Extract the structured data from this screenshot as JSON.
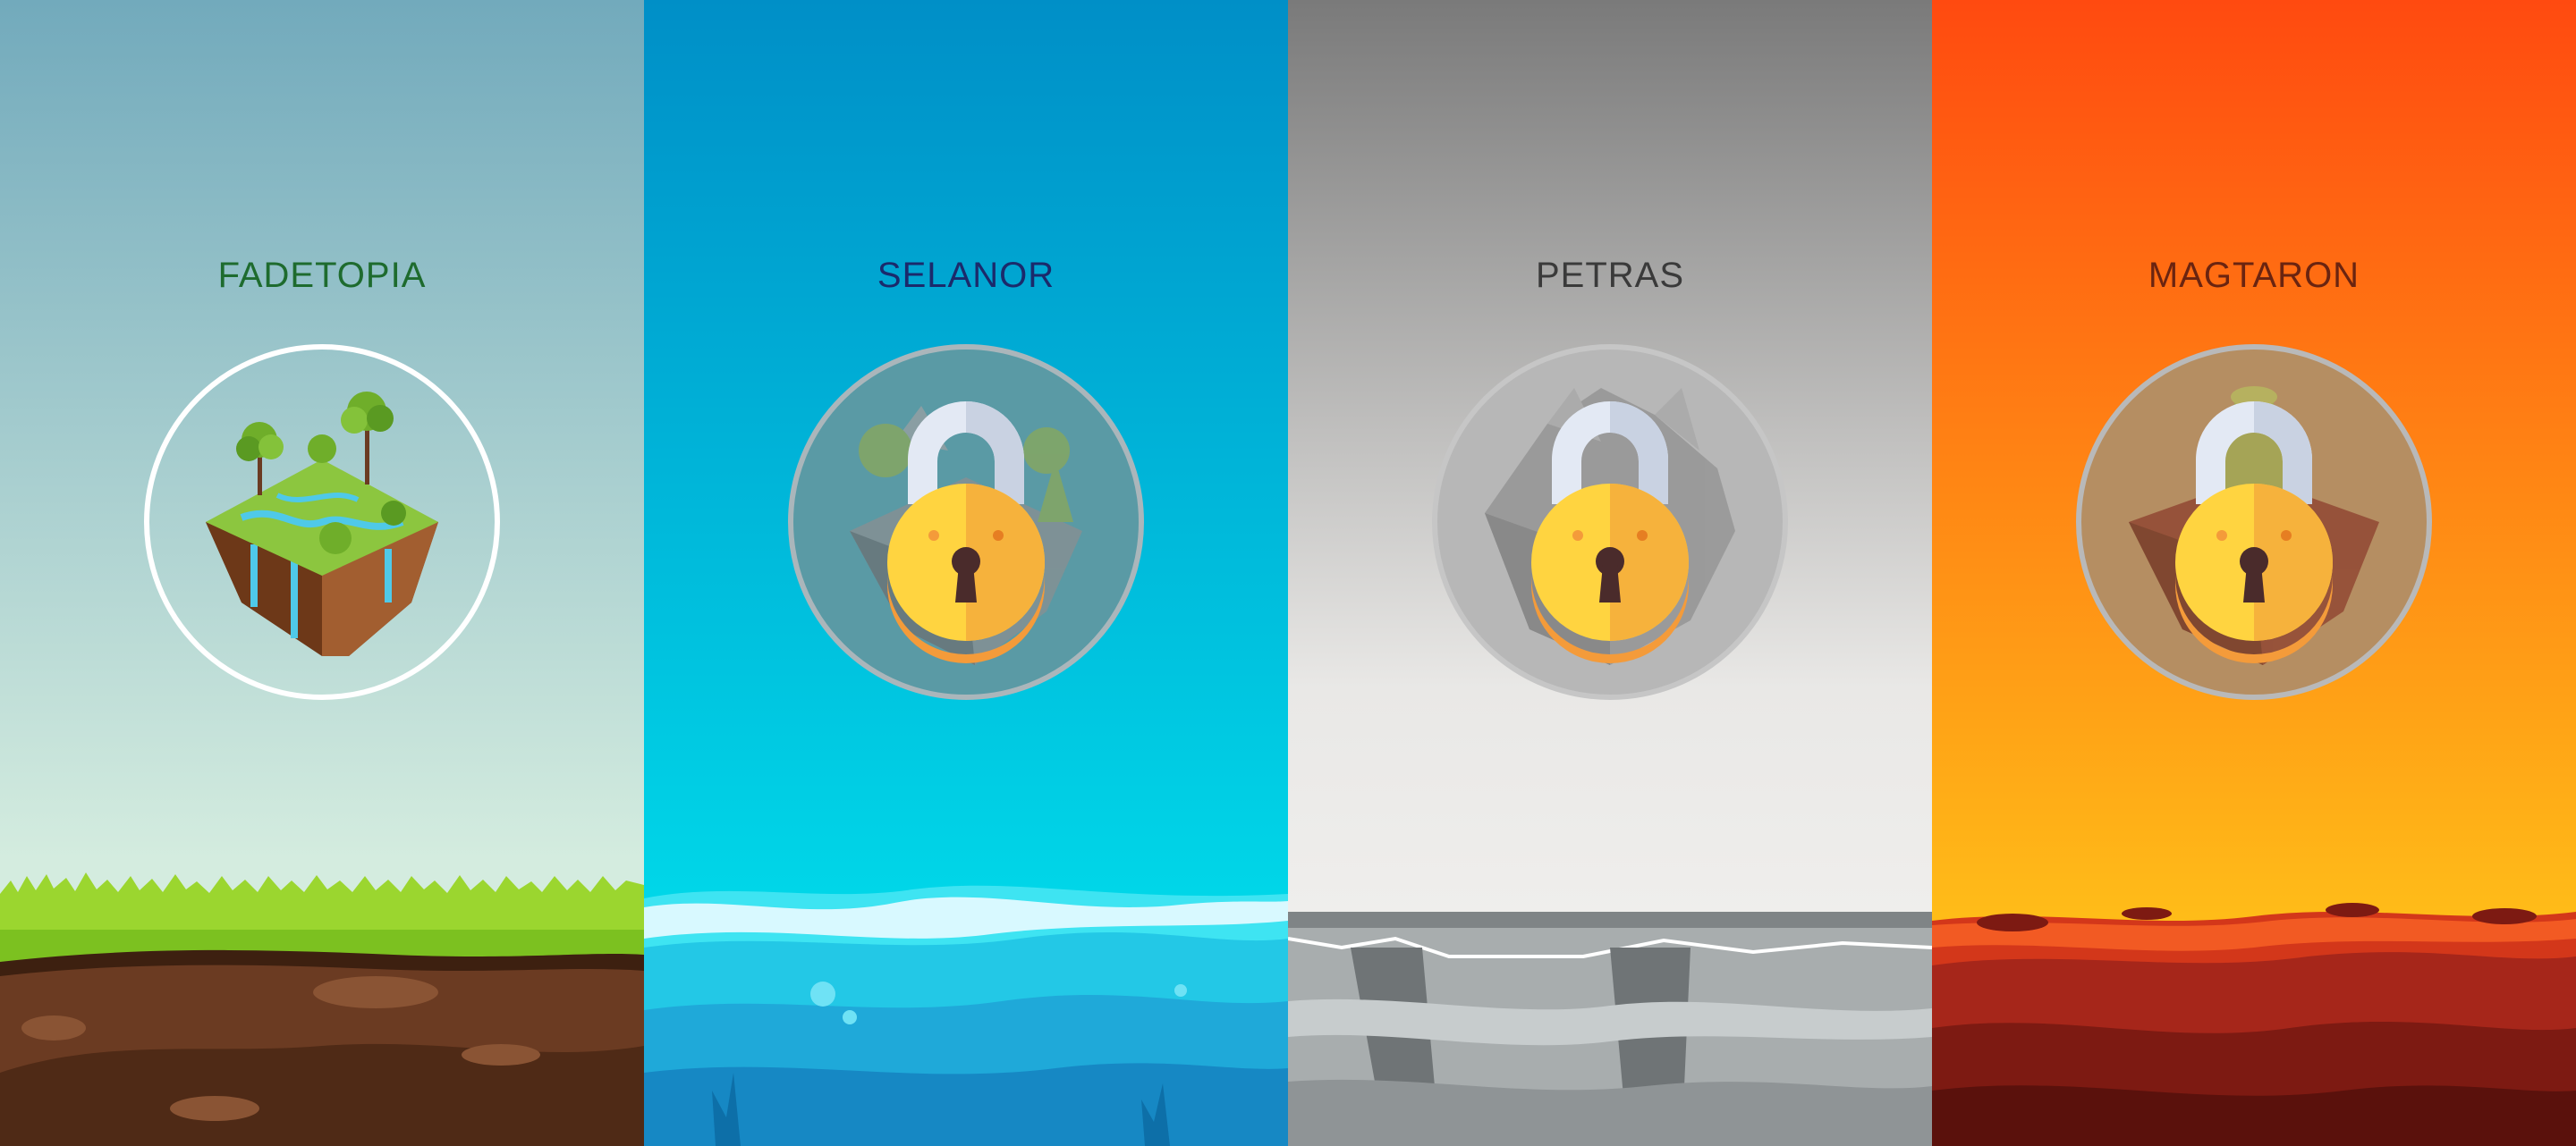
{
  "worlds": [
    {
      "name": "FADETOPIA",
      "locked": false,
      "title_color": "#1e6b2e",
      "sky_top": "#72aabc",
      "sky_bottom": "#d4ecdf",
      "icon": "forest-island-icon"
    },
    {
      "name": "SELANOR",
      "locked": true,
      "title_color": "#1b2a6b",
      "sky_top": "#008fc7",
      "sky_bottom": "#00d6e8",
      "icon": "tropical-island-icon"
    },
    {
      "name": "PETRAS",
      "locked": true,
      "title_color": "#3a3a3a",
      "sky_top": "#7a7a7a",
      "sky_bottom": "#efeeec",
      "icon": "rock-island-icon"
    },
    {
      "name": "MAGTARON",
      "locked": true,
      "title_color": "#6a2410",
      "sky_top": "#ff4a10",
      "sky_bottom": "#ffbc18",
      "icon": "volcano-island-icon"
    }
  ],
  "lock_icon": "padlock-icon"
}
